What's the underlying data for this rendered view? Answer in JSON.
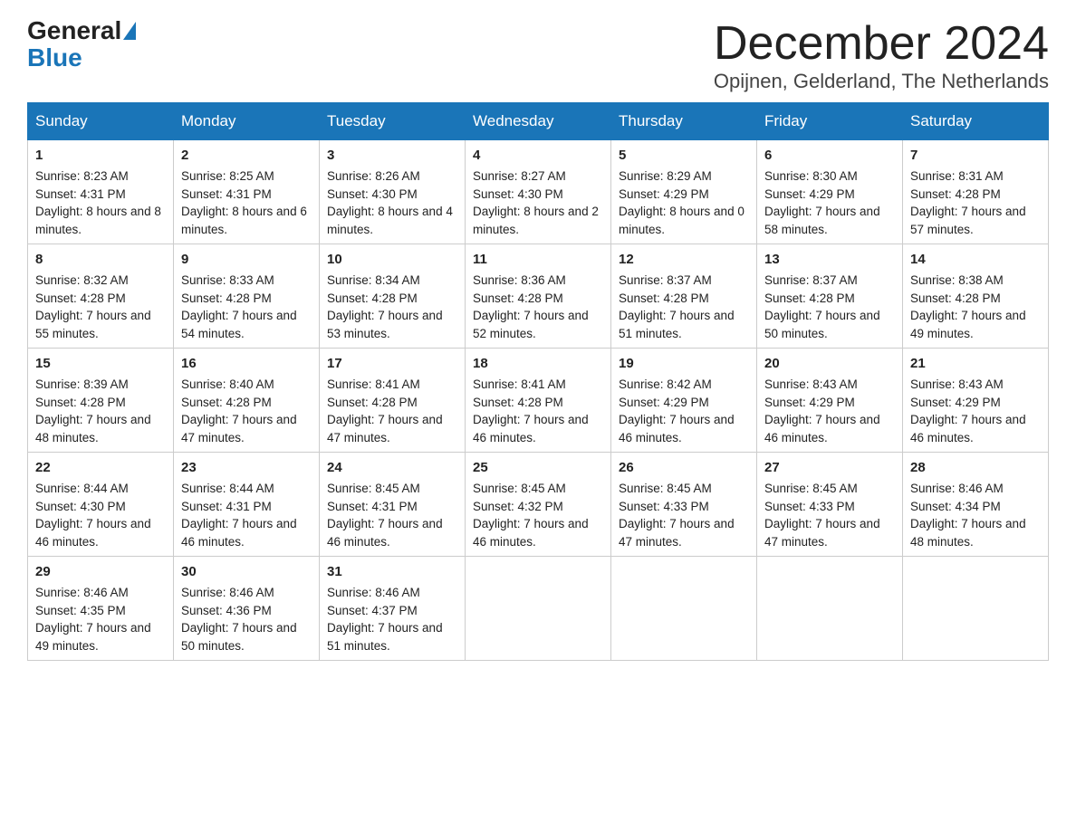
{
  "header": {
    "logo_general": "General",
    "logo_blue": "Blue",
    "month_title": "December 2024",
    "location": "Opijnen, Gelderland, The Netherlands"
  },
  "days_of_week": [
    "Sunday",
    "Monday",
    "Tuesday",
    "Wednesday",
    "Thursday",
    "Friday",
    "Saturday"
  ],
  "weeks": [
    [
      {
        "day": "1",
        "sunrise": "Sunrise: 8:23 AM",
        "sunset": "Sunset: 4:31 PM",
        "daylight": "Daylight: 8 hours and 8 minutes."
      },
      {
        "day": "2",
        "sunrise": "Sunrise: 8:25 AM",
        "sunset": "Sunset: 4:31 PM",
        "daylight": "Daylight: 8 hours and 6 minutes."
      },
      {
        "day": "3",
        "sunrise": "Sunrise: 8:26 AM",
        "sunset": "Sunset: 4:30 PM",
        "daylight": "Daylight: 8 hours and 4 minutes."
      },
      {
        "day": "4",
        "sunrise": "Sunrise: 8:27 AM",
        "sunset": "Sunset: 4:30 PM",
        "daylight": "Daylight: 8 hours and 2 minutes."
      },
      {
        "day": "5",
        "sunrise": "Sunrise: 8:29 AM",
        "sunset": "Sunset: 4:29 PM",
        "daylight": "Daylight: 8 hours and 0 minutes."
      },
      {
        "day": "6",
        "sunrise": "Sunrise: 8:30 AM",
        "sunset": "Sunset: 4:29 PM",
        "daylight": "Daylight: 7 hours and 58 minutes."
      },
      {
        "day": "7",
        "sunrise": "Sunrise: 8:31 AM",
        "sunset": "Sunset: 4:28 PM",
        "daylight": "Daylight: 7 hours and 57 minutes."
      }
    ],
    [
      {
        "day": "8",
        "sunrise": "Sunrise: 8:32 AM",
        "sunset": "Sunset: 4:28 PM",
        "daylight": "Daylight: 7 hours and 55 minutes."
      },
      {
        "day": "9",
        "sunrise": "Sunrise: 8:33 AM",
        "sunset": "Sunset: 4:28 PM",
        "daylight": "Daylight: 7 hours and 54 minutes."
      },
      {
        "day": "10",
        "sunrise": "Sunrise: 8:34 AM",
        "sunset": "Sunset: 4:28 PM",
        "daylight": "Daylight: 7 hours and 53 minutes."
      },
      {
        "day": "11",
        "sunrise": "Sunrise: 8:36 AM",
        "sunset": "Sunset: 4:28 PM",
        "daylight": "Daylight: 7 hours and 52 minutes."
      },
      {
        "day": "12",
        "sunrise": "Sunrise: 8:37 AM",
        "sunset": "Sunset: 4:28 PM",
        "daylight": "Daylight: 7 hours and 51 minutes."
      },
      {
        "day": "13",
        "sunrise": "Sunrise: 8:37 AM",
        "sunset": "Sunset: 4:28 PM",
        "daylight": "Daylight: 7 hours and 50 minutes."
      },
      {
        "day": "14",
        "sunrise": "Sunrise: 8:38 AM",
        "sunset": "Sunset: 4:28 PM",
        "daylight": "Daylight: 7 hours and 49 minutes."
      }
    ],
    [
      {
        "day": "15",
        "sunrise": "Sunrise: 8:39 AM",
        "sunset": "Sunset: 4:28 PM",
        "daylight": "Daylight: 7 hours and 48 minutes."
      },
      {
        "day": "16",
        "sunrise": "Sunrise: 8:40 AM",
        "sunset": "Sunset: 4:28 PM",
        "daylight": "Daylight: 7 hours and 47 minutes."
      },
      {
        "day": "17",
        "sunrise": "Sunrise: 8:41 AM",
        "sunset": "Sunset: 4:28 PM",
        "daylight": "Daylight: 7 hours and 47 minutes."
      },
      {
        "day": "18",
        "sunrise": "Sunrise: 8:41 AM",
        "sunset": "Sunset: 4:28 PM",
        "daylight": "Daylight: 7 hours and 46 minutes."
      },
      {
        "day": "19",
        "sunrise": "Sunrise: 8:42 AM",
        "sunset": "Sunset: 4:29 PM",
        "daylight": "Daylight: 7 hours and 46 minutes."
      },
      {
        "day": "20",
        "sunrise": "Sunrise: 8:43 AM",
        "sunset": "Sunset: 4:29 PM",
        "daylight": "Daylight: 7 hours and 46 minutes."
      },
      {
        "day": "21",
        "sunrise": "Sunrise: 8:43 AM",
        "sunset": "Sunset: 4:29 PM",
        "daylight": "Daylight: 7 hours and 46 minutes."
      }
    ],
    [
      {
        "day": "22",
        "sunrise": "Sunrise: 8:44 AM",
        "sunset": "Sunset: 4:30 PM",
        "daylight": "Daylight: 7 hours and 46 minutes."
      },
      {
        "day": "23",
        "sunrise": "Sunrise: 8:44 AM",
        "sunset": "Sunset: 4:31 PM",
        "daylight": "Daylight: 7 hours and 46 minutes."
      },
      {
        "day": "24",
        "sunrise": "Sunrise: 8:45 AM",
        "sunset": "Sunset: 4:31 PM",
        "daylight": "Daylight: 7 hours and 46 minutes."
      },
      {
        "day": "25",
        "sunrise": "Sunrise: 8:45 AM",
        "sunset": "Sunset: 4:32 PM",
        "daylight": "Daylight: 7 hours and 46 minutes."
      },
      {
        "day": "26",
        "sunrise": "Sunrise: 8:45 AM",
        "sunset": "Sunset: 4:33 PM",
        "daylight": "Daylight: 7 hours and 47 minutes."
      },
      {
        "day": "27",
        "sunrise": "Sunrise: 8:45 AM",
        "sunset": "Sunset: 4:33 PM",
        "daylight": "Daylight: 7 hours and 47 minutes."
      },
      {
        "day": "28",
        "sunrise": "Sunrise: 8:46 AM",
        "sunset": "Sunset: 4:34 PM",
        "daylight": "Daylight: 7 hours and 48 minutes."
      }
    ],
    [
      {
        "day": "29",
        "sunrise": "Sunrise: 8:46 AM",
        "sunset": "Sunset: 4:35 PM",
        "daylight": "Daylight: 7 hours and 49 minutes."
      },
      {
        "day": "30",
        "sunrise": "Sunrise: 8:46 AM",
        "sunset": "Sunset: 4:36 PM",
        "daylight": "Daylight: 7 hours and 50 minutes."
      },
      {
        "day": "31",
        "sunrise": "Sunrise: 8:46 AM",
        "sunset": "Sunset: 4:37 PM",
        "daylight": "Daylight: 7 hours and 51 minutes."
      },
      null,
      null,
      null,
      null
    ]
  ]
}
